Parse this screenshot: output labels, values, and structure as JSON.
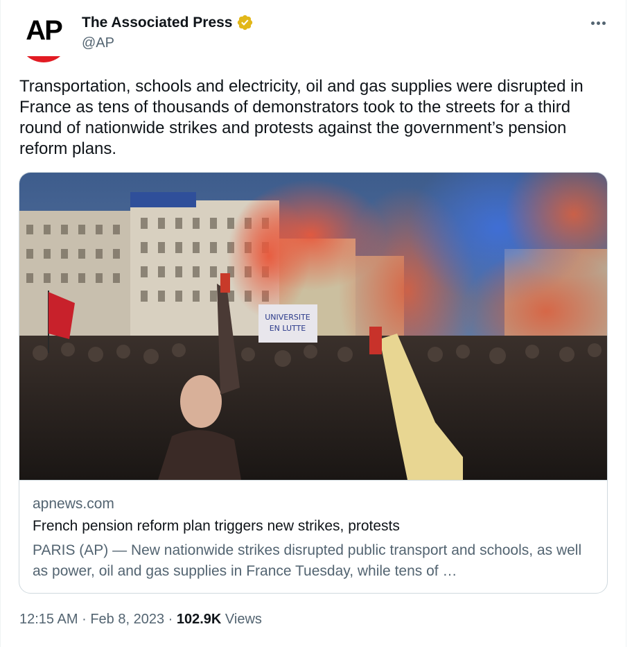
{
  "author": {
    "display_name": "The Associated Press",
    "handle": "@AP",
    "avatar_logo_text": "AP",
    "verified_badge_icon": "verified-gold-badge-icon",
    "verified_color": "#e2b719",
    "avatar_bar_color": "#e21b23"
  },
  "more_icon": "more-horizontal-icon",
  "tweet_text": "Transportation, schools and electricity, oil and gas supplies were disrupted in France as tens of thousands of demonstrators took to the streets for a third round of nationwide strikes and protests against the government’s pension reform plans.",
  "card": {
    "domain": "apnews.com",
    "title": "French pension reform plan triggers new strikes, protests",
    "description": "PARIS (AP) — New nationwide strikes disrupted public transport and schools, as well as power, oil and gas supplies in France Tuesday, while tens of …",
    "image_banner_text": "UNIVERSITE EN LUTTE",
    "image_description_icon": "protest-photo"
  },
  "meta": {
    "time": "12:15 AM",
    "separator": "·",
    "date": "Feb 8, 2023",
    "views_count": "102.9K",
    "views_label": "Views"
  },
  "colors": {
    "text_primary": "#0f1419",
    "text_secondary": "#536471",
    "border": "#cfd9de"
  }
}
